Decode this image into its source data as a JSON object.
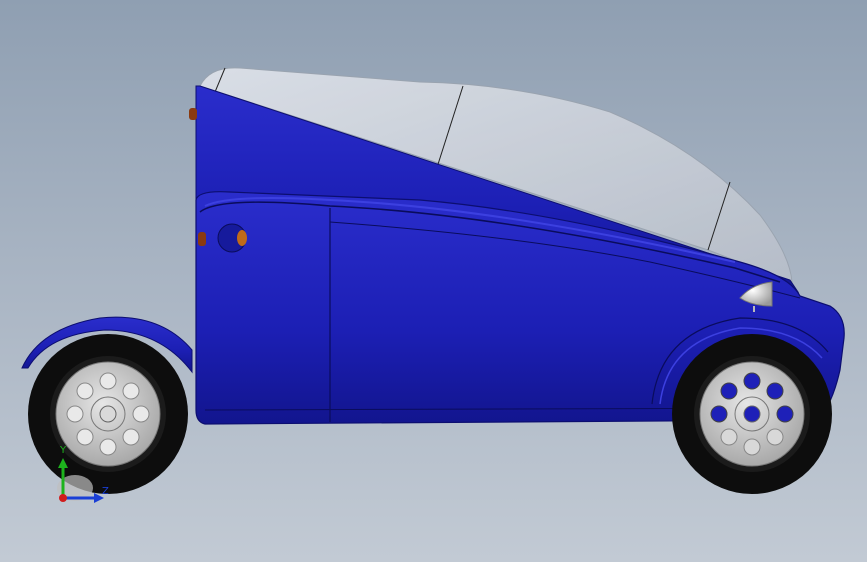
{
  "viewport": {
    "background_top": "#8f9fb2",
    "background_bottom": "#c2cad4"
  },
  "model": {
    "type": "three-wheel-vehicle-side-view",
    "body_color": "#1e20b8",
    "body_shadow_color": "#10138a",
    "canopy_color": "#c6ccd6",
    "tire_color": "#0d0d0d",
    "rim_color": "#c9c9c9",
    "lamp_color": "#c06a1a",
    "front_lamp_color": "#e0e0e0"
  },
  "triad": {
    "y_label": "Y",
    "z_label": "Z",
    "y_color": "#1db31d",
    "z_color": "#1a3fd6",
    "origin_color": "#d01c1c"
  }
}
